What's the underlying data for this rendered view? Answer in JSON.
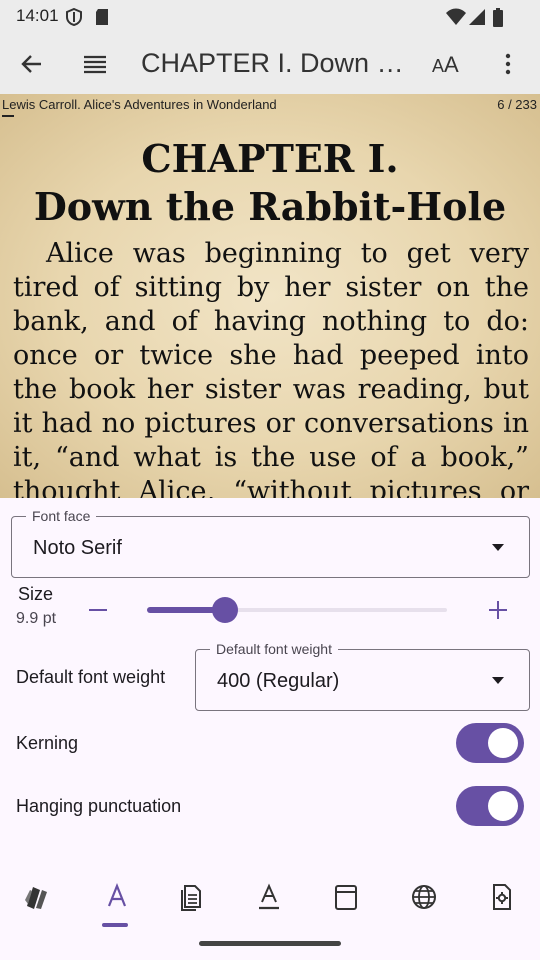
{
  "status_bar": {
    "time": "14:01"
  },
  "app_bar": {
    "title": "CHAPTER I. Down the Rabbit-Hole",
    "back_icon": "arrow-back-icon",
    "toc_icon": "toc-icon",
    "text_icon": "text-size-icon",
    "more_icon": "more-vert-icon"
  },
  "reader": {
    "header_left": "Lewis Carroll.  Alice's Adventures in Wonderland",
    "header_right": "6 / 233",
    "chapter_line1": "CHAPTER I.",
    "chapter_line2": "Down the Rabbit-Hole",
    "paragraph": "Alice was beginning to get very tired of sitting by her sister on the bank, and of having nothing to do: once or twice she had peeped into the book her sister was reading, but it had no pictures or conversations in it, “and what is the use of a book,” thought Alice, “without pictures or conversations?”"
  },
  "panel": {
    "font_face": {
      "label": "Font face",
      "value": "Noto Serif"
    },
    "size": {
      "label": "Size",
      "value": "9.9 pt",
      "level": 0.26
    },
    "weight_row_label": "Default font weight",
    "weight": {
      "label": "Default font weight",
      "value": "400 (Regular)"
    },
    "kerning": {
      "label": "Kerning",
      "on": true
    },
    "hanging": {
      "label": "Hanging punctuation",
      "on": true
    }
  },
  "bottom_nav": [
    "color-palette-icon",
    "font-icon",
    "document-icon",
    "text-format-icon",
    "layout-icon",
    "language-icon",
    "settings-icon"
  ],
  "colors": {
    "accent": "#6750a4",
    "track": "#e7e0ec",
    "paper": "#ecdcb8"
  }
}
